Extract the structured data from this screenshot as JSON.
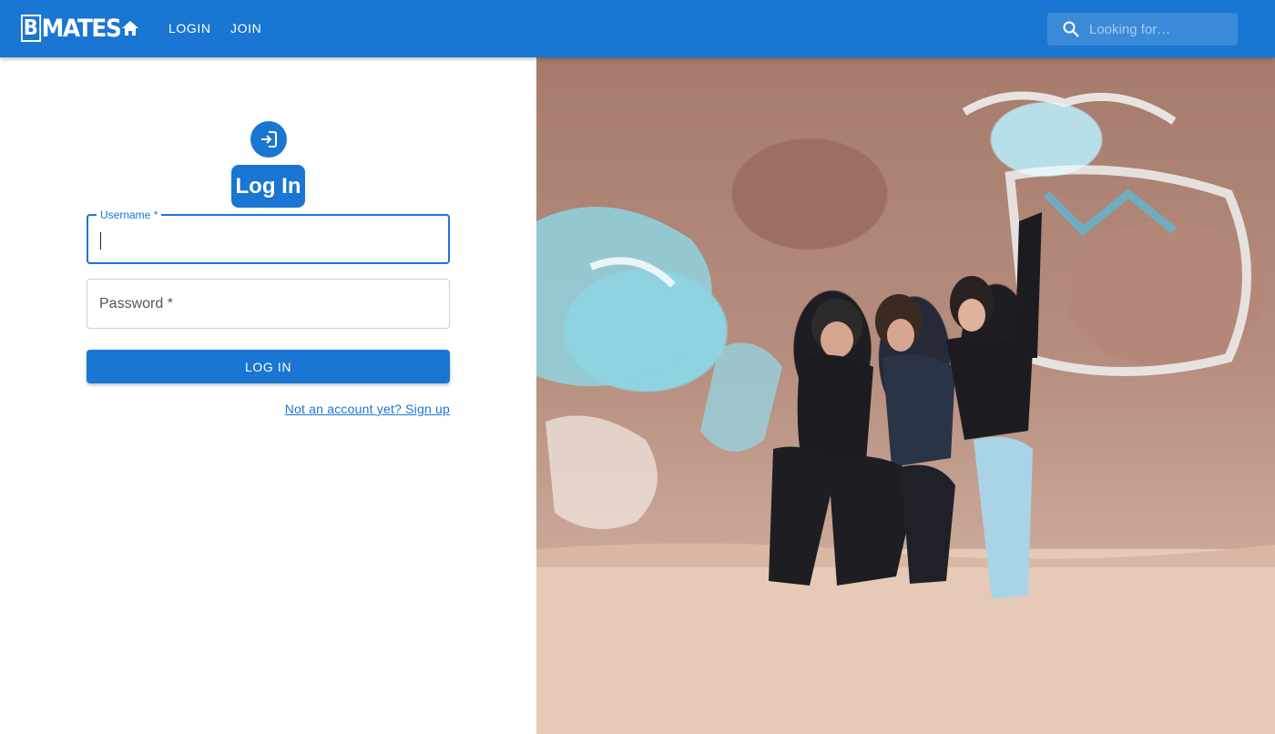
{
  "app": {
    "logo_prefix": "B",
    "logo_text": "MATES"
  },
  "nav": {
    "home_icon": "home-icon",
    "items": [
      {
        "label": "LOGIN"
      },
      {
        "label": "JOIN"
      }
    ]
  },
  "search": {
    "icon": "search-icon",
    "placeholder": "Looking for…",
    "value": ""
  },
  "login": {
    "icon": "login-icon",
    "title": "Log In",
    "username": {
      "label": "Username *",
      "value": ""
    },
    "password": {
      "label": "Password *",
      "value": ""
    },
    "submit_label": "LOG IN",
    "signup_link": "Not an account yet? Sign up"
  },
  "colors": {
    "primary": "#1976d2",
    "background": "#ffffff",
    "input_border": "#d8cfc2"
  },
  "hero": {
    "description_icon": "photo"
  }
}
